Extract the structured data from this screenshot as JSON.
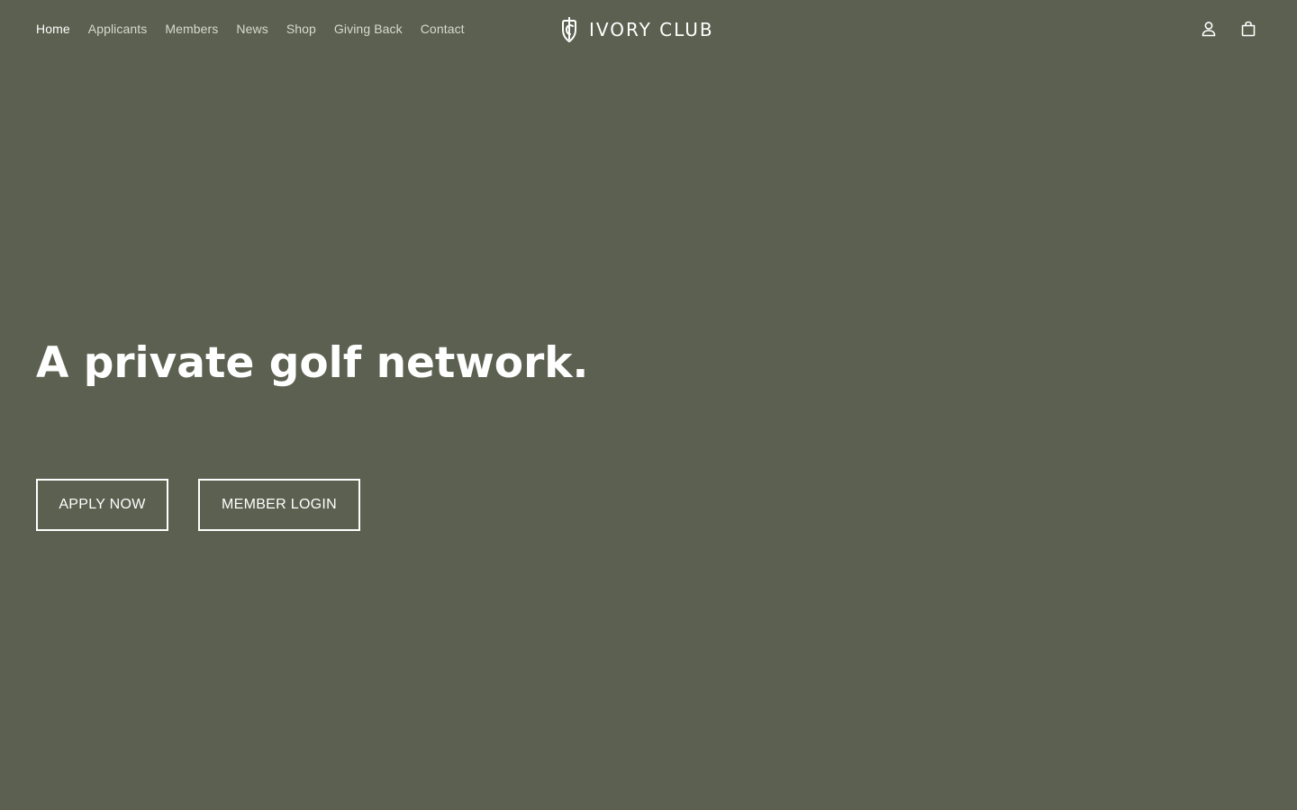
{
  "colors": {
    "background": "#5c6050",
    "text": "#ffffff",
    "nav_text": "#d7d9cf"
  },
  "nav": {
    "items": [
      {
        "label": "Home",
        "active": true
      },
      {
        "label": "Applicants",
        "active": false
      },
      {
        "label": "Members",
        "active": false
      },
      {
        "label": "News",
        "active": false
      },
      {
        "label": "Shop",
        "active": false
      },
      {
        "label": "Giving Back",
        "active": false
      },
      {
        "label": "Contact",
        "active": false
      }
    ]
  },
  "brand": {
    "name": "IVORY CLUB",
    "mark_icon": "shield-club-icon"
  },
  "header_icons": {
    "account": "user-icon",
    "cart": "shopping-bag-icon"
  },
  "hero": {
    "title": "A private golf network.",
    "buttons": {
      "apply": "APPLY NOW",
      "login": "MEMBER LOGIN"
    }
  }
}
